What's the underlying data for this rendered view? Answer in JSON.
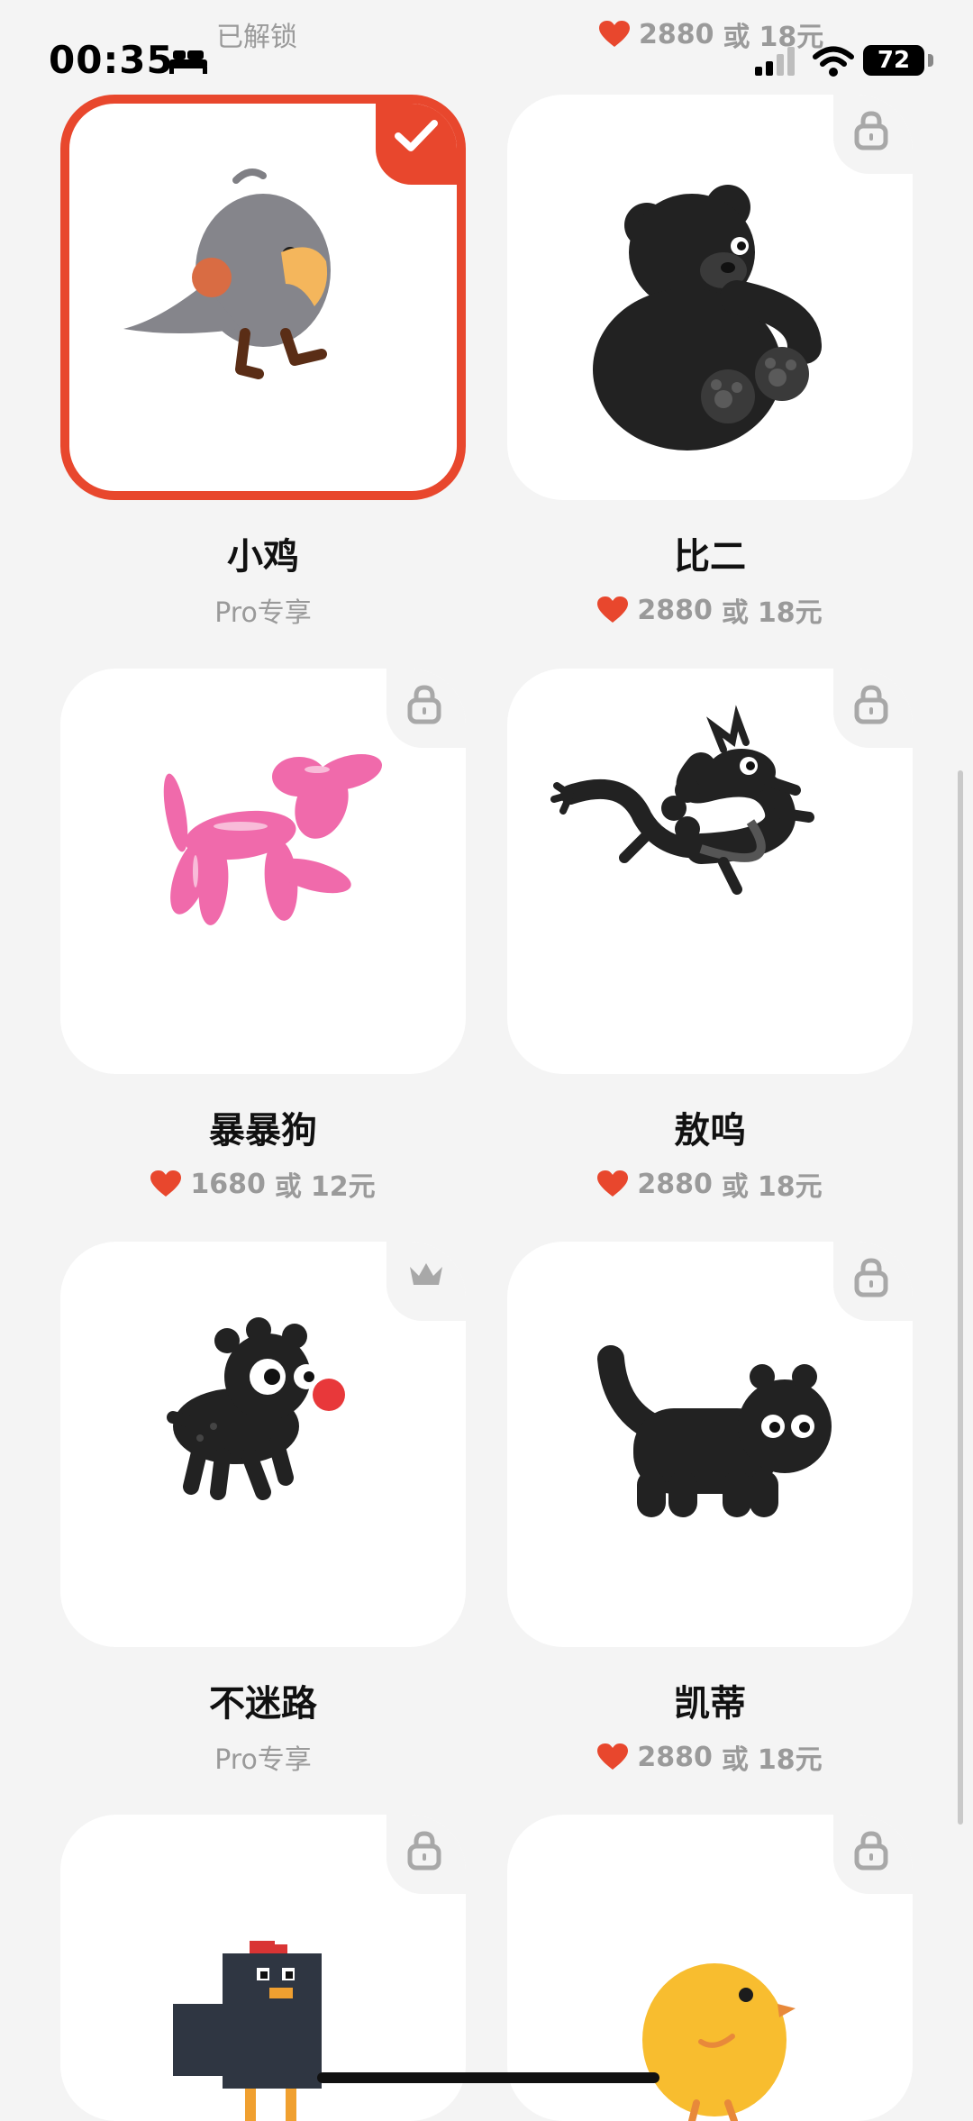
{
  "status_bar": {
    "time": "00:35",
    "battery": "72"
  },
  "top_partial": {
    "left_sub": "已解锁",
    "right_price": {
      "hearts": "2880",
      "or": "或",
      "money": "18元"
    }
  },
  "items": [
    {
      "name": "小鸡",
      "sub_type": "pro",
      "sub_text": "Pro专享",
      "state": "selected",
      "badge_icon": "checkmark-icon"
    },
    {
      "name": "比二",
      "sub_type": "price",
      "hearts": "2880",
      "or": "或",
      "money": "18元",
      "state": "locked",
      "badge_icon": "lock-icon"
    },
    {
      "name": "暴暴狗",
      "sub_type": "price",
      "hearts": "1680",
      "or": "或",
      "money": "12元",
      "state": "locked",
      "badge_icon": "lock-icon"
    },
    {
      "name": "敖呜",
      "sub_type": "price",
      "hearts": "2880",
      "or": "或",
      "money": "18元",
      "state": "locked",
      "badge_icon": "lock-icon"
    },
    {
      "name": "不迷路",
      "sub_type": "pro",
      "sub_text": "Pro专享",
      "state": "pro",
      "badge_icon": "crown-icon"
    },
    {
      "name": "凯蒂",
      "sub_type": "price",
      "hearts": "2880",
      "or": "或",
      "money": "18元",
      "state": "locked",
      "badge_icon": "lock-icon"
    },
    {
      "name": "",
      "state": "locked",
      "badge_icon": "lock-icon"
    },
    {
      "name": "",
      "state": "locked",
      "badge_icon": "lock-icon"
    }
  ],
  "colors": {
    "accent": "#e8472d",
    "heart": "#e8472d",
    "card": "#ffffff",
    "background": "#f4f4f4",
    "muted": "#9a9a9a"
  }
}
